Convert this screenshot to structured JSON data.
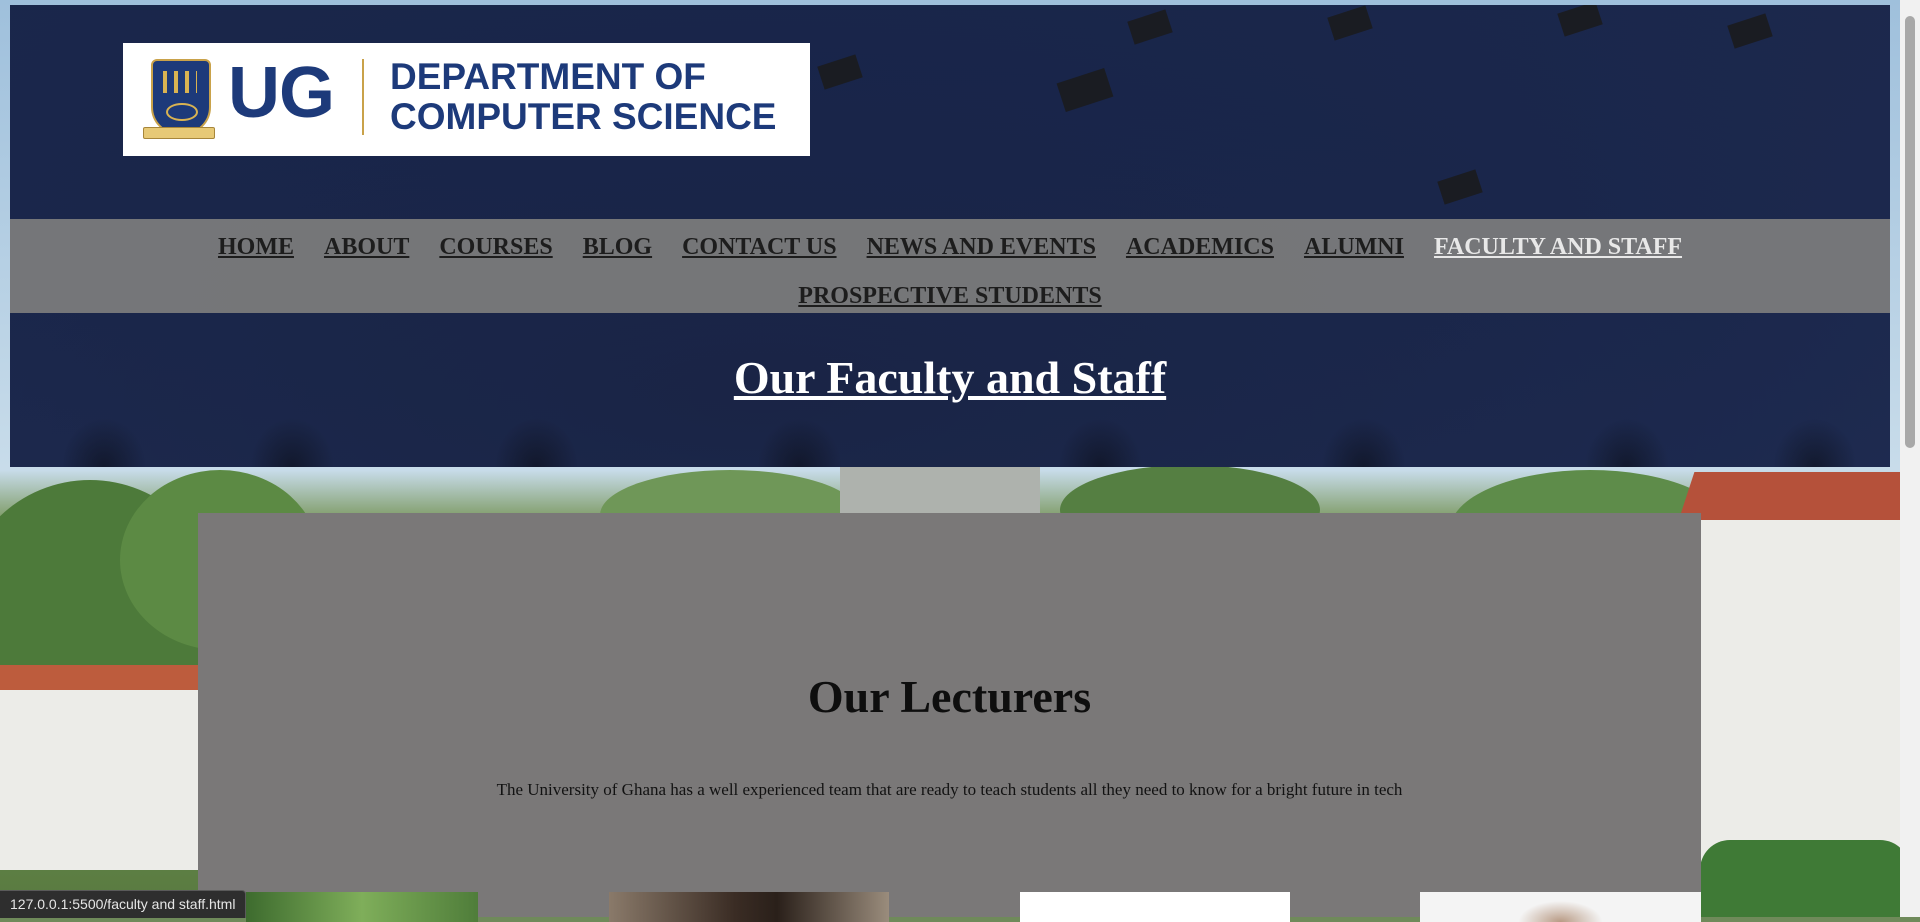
{
  "brand": {
    "logo_mark": "UG",
    "logo_text_line1": "DEPARTMENT OF",
    "logo_text_line2": "COMPUTER SCIENCE"
  },
  "nav": {
    "items": [
      {
        "label": "HOME",
        "active": false
      },
      {
        "label": "ABOUT",
        "active": false
      },
      {
        "label": "COURSES",
        "active": false
      },
      {
        "label": "BLOG",
        "active": false
      },
      {
        "label": "CONTACT US",
        "active": false
      },
      {
        "label": "NEWS AND EVENTS",
        "active": false
      },
      {
        "label": "ACADEMICS",
        "active": false
      },
      {
        "label": "ALUMNI",
        "active": false
      },
      {
        "label": "FACULTY AND STAFF",
        "active": true
      },
      {
        "label": "PROSPECTIVE STUDENTS",
        "active": false
      }
    ]
  },
  "hero": {
    "heading": "Our Faculty and Staff"
  },
  "lecturers": {
    "title": "Our Lecturers",
    "description": "The University of Ghana has a well experienced team that are ready to teach students all they need to know for a bright future in tech"
  },
  "status_bar": {
    "url": "127.0.0.1:5500/faculty and staff.html"
  },
  "colors": {
    "brand_blue": "#1d3a7a",
    "header_overlay": "#18244a",
    "nav_bar": "#7d7d7d",
    "panel": "#7a7878"
  }
}
